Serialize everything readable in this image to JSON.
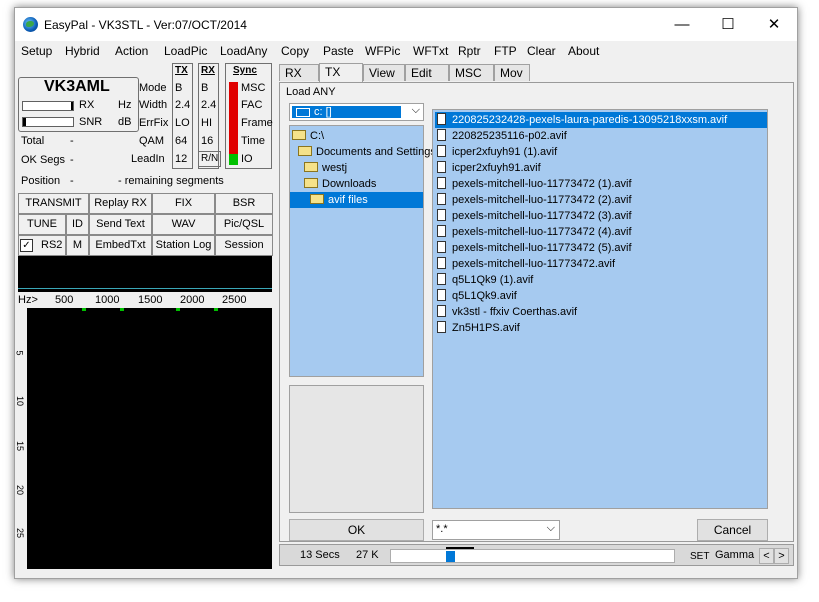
{
  "window": {
    "title": "EasyPal - VK3STL - Ver:07/OCT/2014",
    "minimize": "—",
    "maximize": "☐",
    "close": "✕"
  },
  "menu": [
    "Setup",
    "Hybrid",
    "Action",
    "LoadPic",
    "LoadAny",
    "Copy",
    "Paste",
    "WFPic",
    "WFTxt",
    "Rptr",
    "FTP",
    "Clear",
    "About"
  ],
  "left": {
    "callsign": "VK3AML",
    "rx_label": "RX",
    "snr_label": "SNR",
    "hz_label": "Hz",
    "db_label": "dB",
    "total_label": "Total",
    "total_value": "-",
    "oksegs_label": "OK Segs",
    "oksegs_value": "-",
    "position_label": "Position",
    "position_value": "-",
    "remaining_label": "- remaining segments",
    "params": {
      "labels": [
        "Mode",
        "Width",
        "ErrFix",
        "QAM",
        "LeadIn"
      ],
      "tx_header": "TX",
      "rx_header": "RX",
      "sync_header": "Sync",
      "tx_values": [
        "B",
        "2.4",
        "LO",
        "64",
        "12"
      ],
      "rx_values": [
        "B",
        "2.4",
        "HI",
        "16",
        "R/N"
      ],
      "sync_labels": [
        "MSC",
        "FAC",
        "Frame",
        "Time",
        "IO"
      ]
    },
    "buttons": {
      "transmit": "TRANSMIT",
      "replay": "Replay RX",
      "fix": "FIX",
      "bsr": "BSR",
      "tune": "TUNE",
      "id": "ID",
      "send_text": "Send Text",
      "wav": "WAV",
      "picqsl": "Pic/QSL",
      "rs2": "RS2",
      "m": "M",
      "embed": "EmbedTxt",
      "station_log": "Station Log",
      "session": "Session"
    },
    "freq_scale": {
      "label": "Hz>",
      "ticks": [
        "500",
        "1000",
        "1500",
        "2000",
        "2500"
      ]
    },
    "time_ticks": [
      "5",
      "10",
      "15",
      "20",
      "25"
    ]
  },
  "tabs": {
    "rx": "RX",
    "tx": "TX",
    "view": "View",
    "edit": "Edit",
    "msc": "MSC",
    "mov": "Mov"
  },
  "dialog": {
    "title": "Load ANY",
    "drive": "c: []",
    "dirs": [
      "C:\\",
      "Documents and Settings",
      "westj",
      "Downloads",
      "avif files"
    ],
    "files": [
      "220825232428-pexels-laura-paredis-13095218xxsm.avif",
      "220825235116-p02.avif",
      "icper2xfuyh91 (1).avif",
      "icper2xfuyh91.avif",
      "pexels-mitchell-luo-11773472 (1).avif",
      "pexels-mitchell-luo-11773472 (2).avif",
      "pexels-mitchell-luo-11773472 (3).avif",
      "pexels-mitchell-luo-11773472 (4).avif",
      "pexels-mitchell-luo-11773472 (5).avif",
      "pexels-mitchell-luo-11773472.avif",
      "q5L1Qk9 (1).avif",
      "q5L1Qk9.avif",
      "vk3stl - ffxiv Coerthas.avif",
      "Zn5H1PS.avif"
    ],
    "ok": "OK",
    "filter": "*.*",
    "cancel": "Cancel"
  },
  "status": {
    "secs": "13 Secs",
    "size": "27 K",
    "set": "SET",
    "gamma": "Gamma",
    "prev": "<",
    "next": ">"
  },
  "colors": {
    "selection": "#0078d7",
    "list_bg": "#a6caf0",
    "led_red": "#e00000",
    "led_green": "#00c000"
  }
}
